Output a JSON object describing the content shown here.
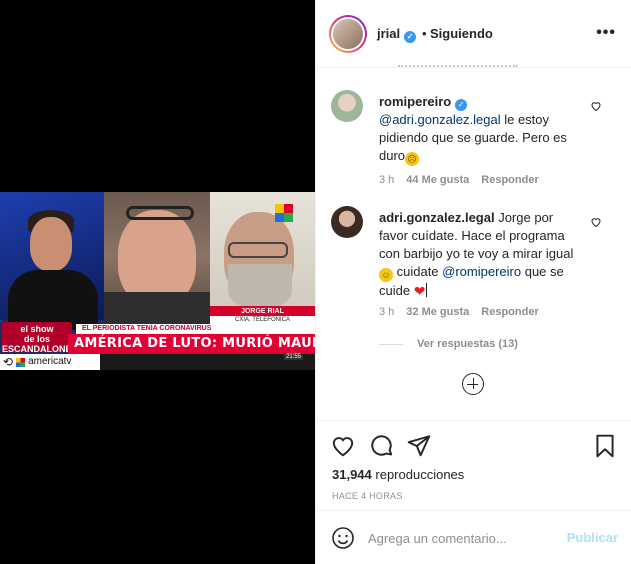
{
  "media": {
    "show_logo_line1": "el show",
    "show_logo_line2": "de los",
    "show_logo_line3": "ESCANDALONES",
    "banner_top": "EL PERIODISTA TENÍA CORONAVIRUS",
    "banner_main": "AMÉRICA DE LUTO: MURIÓ MAURO VIALE",
    "name_tag": "JORGE RIAL",
    "name_sub": "CXIA. TELEFONICA",
    "clock": "21:55",
    "regram_account": "americatv"
  },
  "header": {
    "username": "jrial",
    "verified": true,
    "follow_status": "Siguiendo",
    "more_icon": "more-horizontal-icon"
  },
  "comments": [
    {
      "username": "romipereiro",
      "verified": true,
      "mention": "@adri.gonzalez.legal",
      "text": " le estoy pidiendo que se guarde. Pero es duro",
      "emoji": "sad-face-emoji",
      "time": "3 h",
      "likes": "44 Me gusta",
      "reply": "Responder"
    },
    {
      "username": "adri.gonzalez.legal",
      "text_before": " Jorge por favor cuídate. Hace el programa con barbijo yo te voy a mirar igual ",
      "emoji": "grin-face-emoji",
      "text_middle": " cuidate ",
      "mention": "@romipereiro",
      "text_after": " que se cuide ",
      "heart_emoji": "red-heart-emoji",
      "time": "3 h",
      "likes": "32 Me gusta",
      "reply": "Responder"
    }
  ],
  "view_replies": "Ver respuestas (13)",
  "actions": {
    "views_count": "31,944",
    "views_label": "reproducciones",
    "posted": "HACE 4 HORAS"
  },
  "composer": {
    "placeholder": "Agrega un comentario...",
    "publish_label": "Publicar"
  },
  "colors": {
    "link": "#00376b",
    "verified": "#3897f0",
    "publish_disabled": "#b2dffc",
    "banner_red": "#e30035"
  }
}
